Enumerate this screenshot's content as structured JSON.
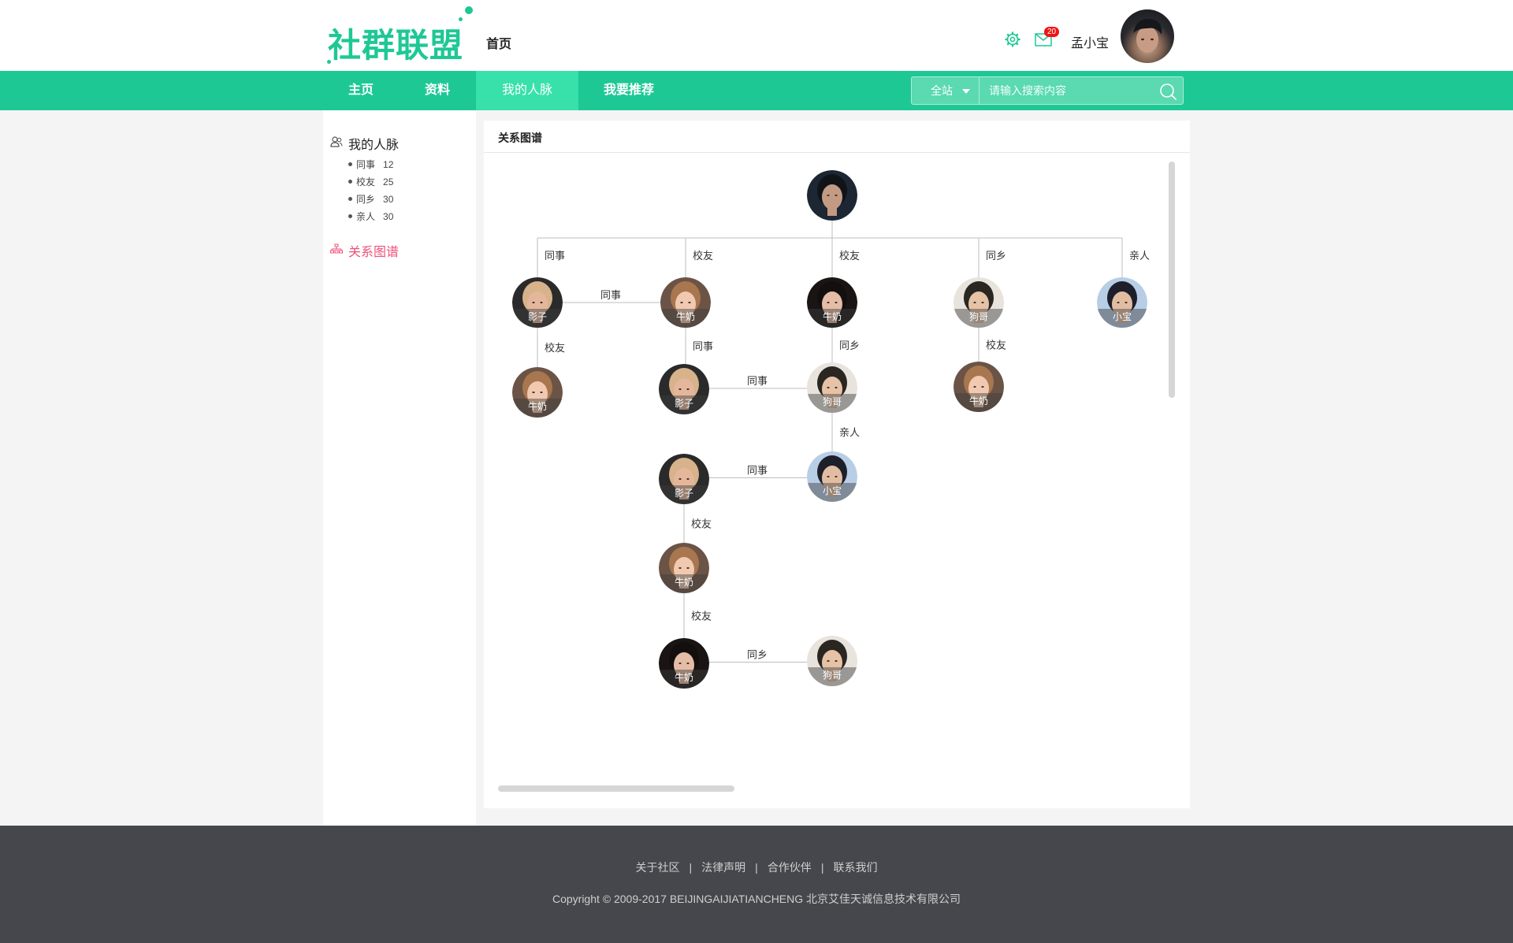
{
  "header": {
    "logo_text": "社群联盟",
    "home_link": "首页",
    "unread_count": "20",
    "username": "孟小宝"
  },
  "nav": {
    "items": [
      "主页",
      "资料",
      "我的人脉",
      "我要推荐"
    ],
    "active_index": 2,
    "search_scope": "全站",
    "search_placeholder": "请输入搜索内容"
  },
  "sidebar": {
    "title": "我的人脉",
    "categories": [
      {
        "label": "同事",
        "count": "12"
      },
      {
        "label": "校友",
        "count": "25"
      },
      {
        "label": "同乡",
        "count": "30"
      },
      {
        "label": "亲人",
        "count": "30"
      }
    ],
    "active_item": "关系图谱"
  },
  "panel": {
    "title": "关系图谱"
  },
  "graph": {
    "root": {
      "id": "root",
      "label": "",
      "style": "dark-boy"
    },
    "nodes": [
      {
        "id": "a1",
        "label": "影子",
        "style": "blonde"
      },
      {
        "id": "a2",
        "label": "牛奶",
        "style": "smile-girl"
      },
      {
        "id": "a3",
        "label": "牛奶",
        "style": "dark-girl"
      },
      {
        "id": "a4",
        "label": "狗哥",
        "style": "boy"
      },
      {
        "id": "a5",
        "label": "小宝",
        "style": "blue-boy"
      },
      {
        "id": "b1",
        "label": "牛奶",
        "style": "smile-girl"
      },
      {
        "id": "b2",
        "label": "影子",
        "style": "blonde"
      },
      {
        "id": "b3",
        "label": "狗哥",
        "style": "boy"
      },
      {
        "id": "b4",
        "label": "牛奶",
        "style": "smile-girl"
      },
      {
        "id": "c1",
        "label": "影子",
        "style": "blonde"
      },
      {
        "id": "c2",
        "label": "小宝",
        "style": "blue-boy"
      },
      {
        "id": "d1",
        "label": "牛奶",
        "style": "smile-girl"
      },
      {
        "id": "e1",
        "label": "牛奶",
        "style": "dark-girl"
      },
      {
        "id": "e2",
        "label": "狗哥",
        "style": "boy"
      }
    ],
    "edges": [
      {
        "from": "root",
        "to": "a1",
        "label": "同事"
      },
      {
        "from": "root",
        "to": "a2",
        "label": "校友"
      },
      {
        "from": "root",
        "to": "a3",
        "label": "校友"
      },
      {
        "from": "root",
        "to": "a4",
        "label": "同乡"
      },
      {
        "from": "root",
        "to": "a5",
        "label": "亲人"
      },
      {
        "from": "a1",
        "to": "a2",
        "label": "同事"
      },
      {
        "from": "a1",
        "to": "b1",
        "label": "校友"
      },
      {
        "from": "a2",
        "to": "b2",
        "label": "同事"
      },
      {
        "from": "a3",
        "to": "b3",
        "label": "同乡"
      },
      {
        "from": "a4",
        "to": "b4",
        "label": "校友"
      },
      {
        "from": "b2",
        "to": "b3",
        "label": "同事"
      },
      {
        "from": "b3",
        "to": "c2",
        "label": "亲人"
      },
      {
        "from": "c1",
        "to": "c2",
        "label": "同事"
      },
      {
        "from": "c1",
        "to": "d1",
        "label": "校友"
      },
      {
        "from": "d1",
        "to": "e1",
        "label": "校友"
      },
      {
        "from": "e1",
        "to": "e2",
        "label": "同乡"
      }
    ]
  },
  "footer": {
    "links": [
      "关于社区",
      "法律声明",
      "合作伙伴",
      "联系我们"
    ],
    "copyright": "Copyright © 2009-2017 BEIJINGAIJIATIANCHENG 北京艾佳天诚信息技术有限公司"
  },
  "colors": {
    "brand": "#1ec895",
    "nav_active": "#38e0aa",
    "sidebar_active": "#ef4f7b",
    "footer_bg": "#45474c",
    "badge": "#f01414"
  }
}
